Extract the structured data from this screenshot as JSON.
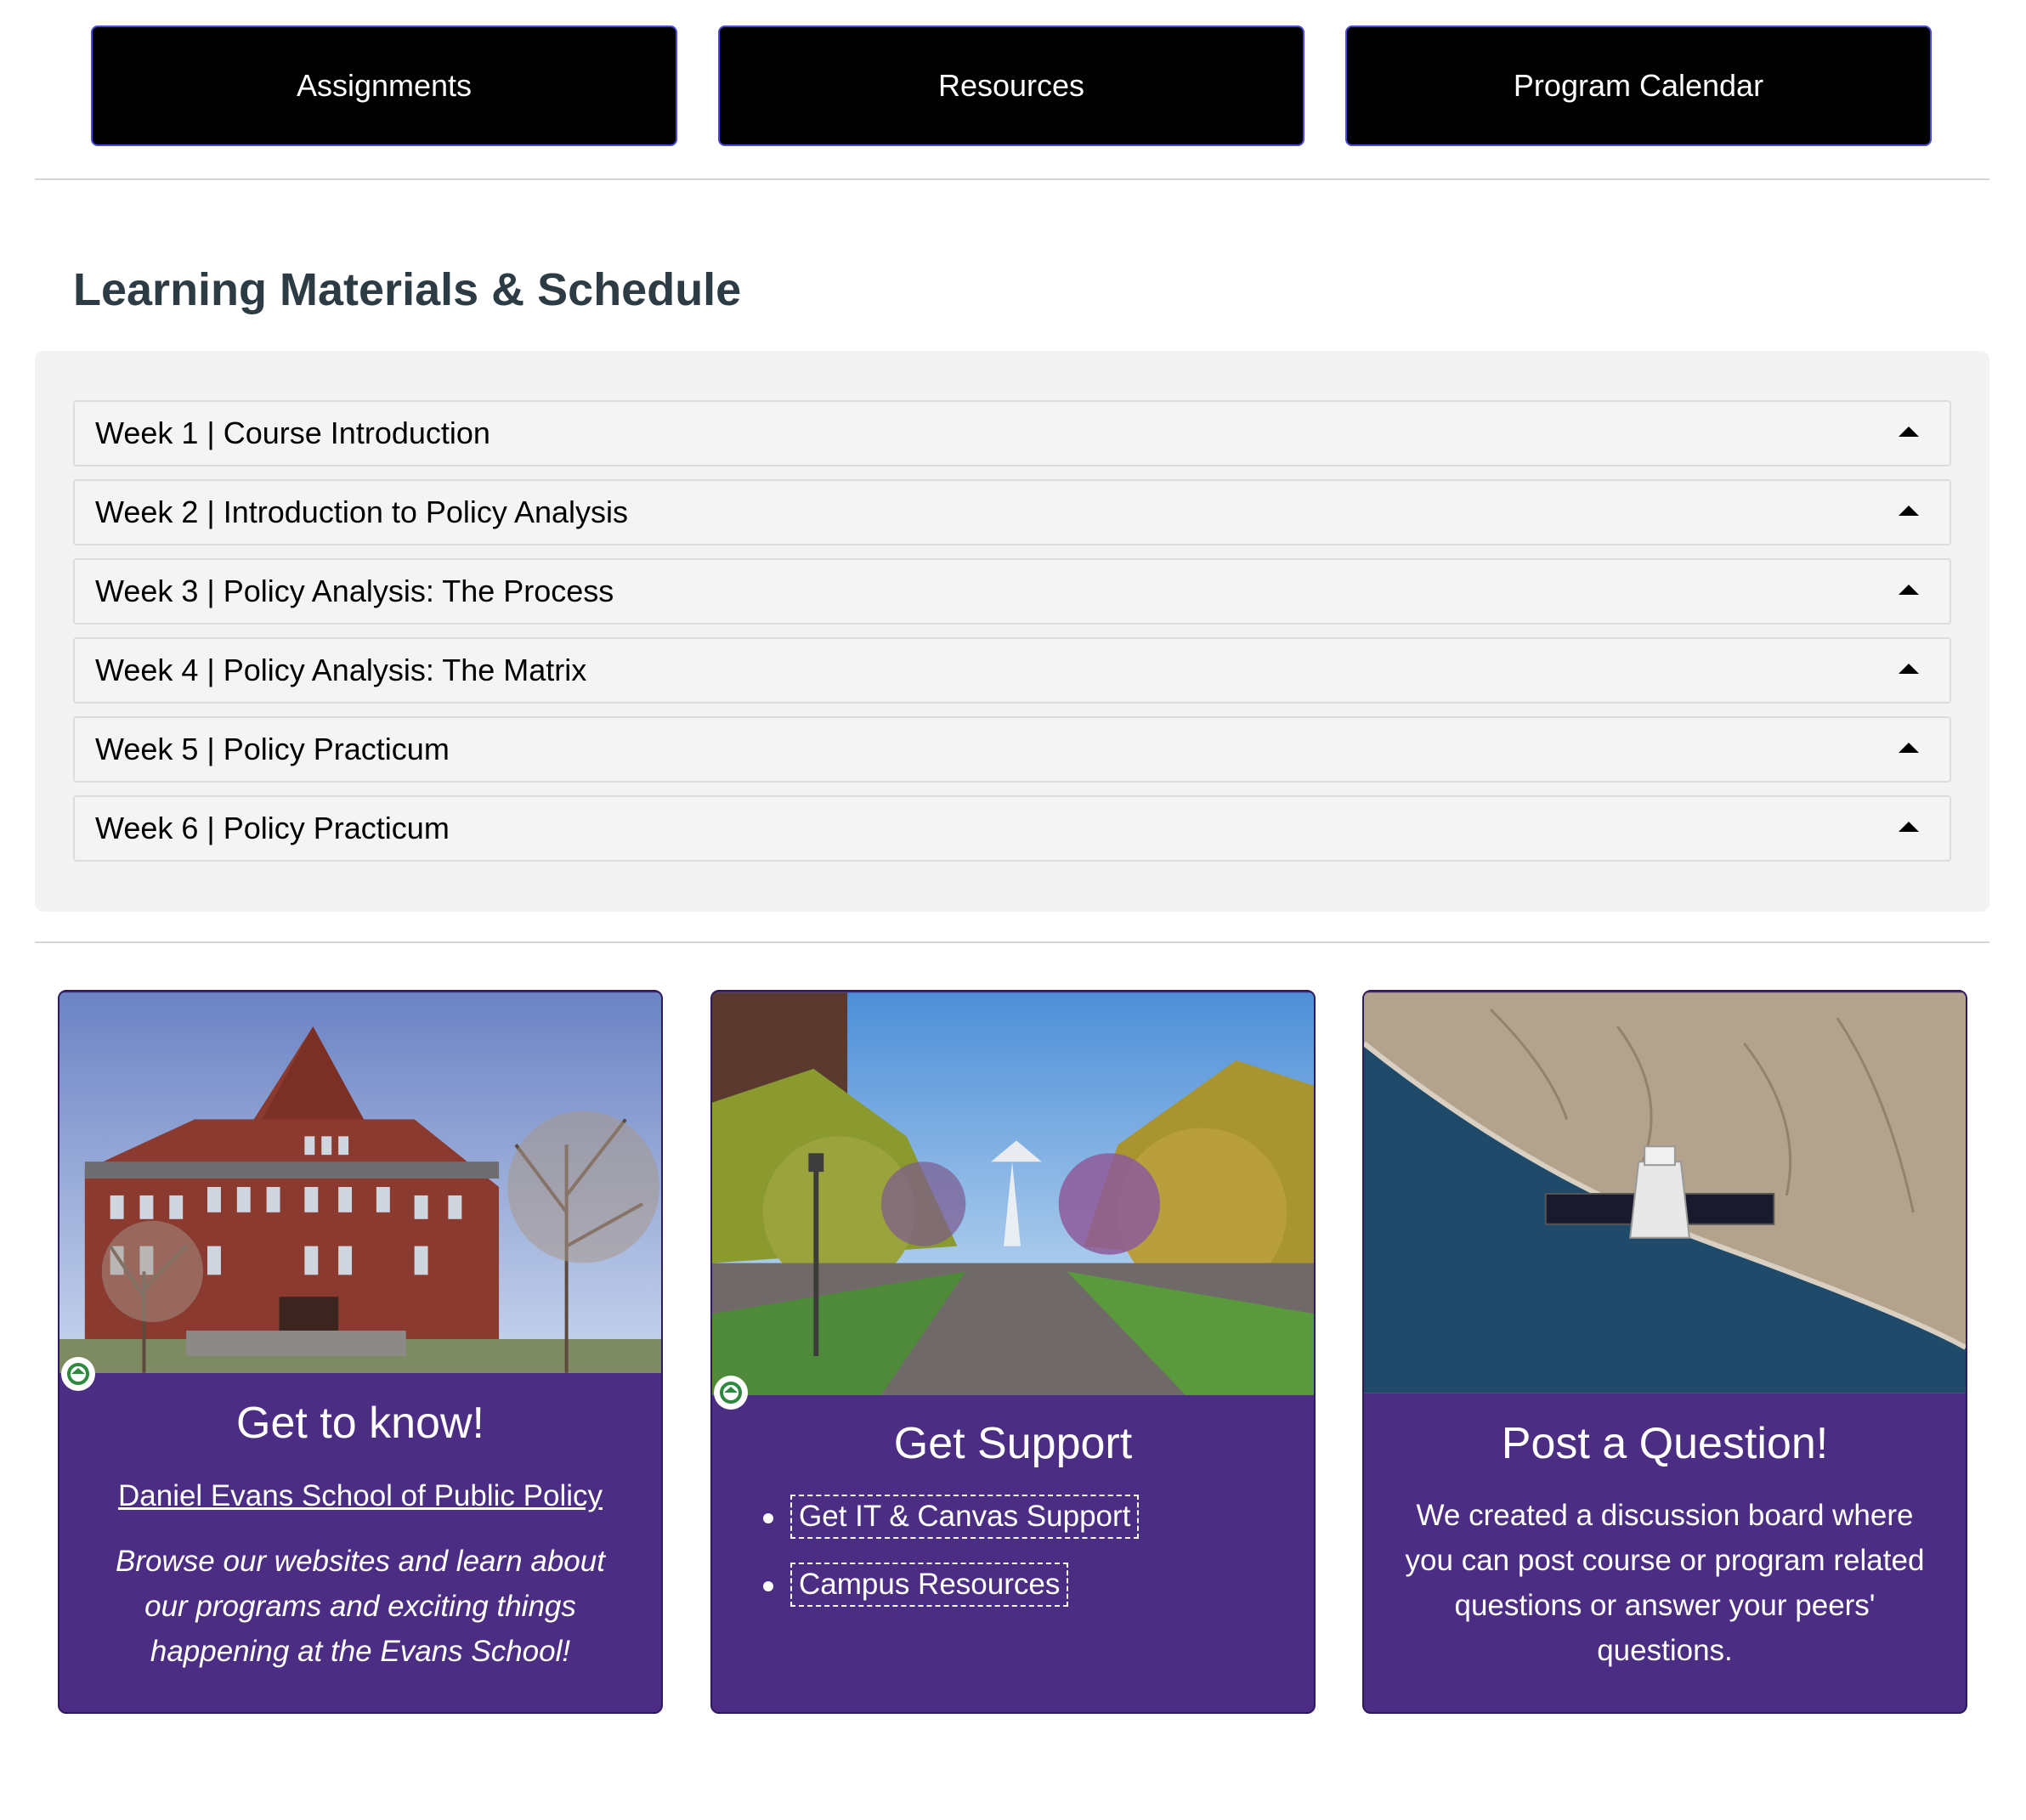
{
  "nav": {
    "buttons": [
      {
        "label": "Assignments"
      },
      {
        "label": "Resources"
      },
      {
        "label": "Program Calendar"
      }
    ]
  },
  "learning": {
    "title": "Learning Materials & Schedule",
    "weeks": [
      {
        "label": "Week 1 | Course Introduction"
      },
      {
        "label": "Week 2 | Introduction to Policy Analysis"
      },
      {
        "label": "Week 3 | Policy Analysis: The Process"
      },
      {
        "label": "Week 4 | Policy Analysis: The Matrix"
      },
      {
        "label": "Week 5 | Policy Practicum"
      },
      {
        "label": "Week 6 | Policy Practicum"
      }
    ]
  },
  "cards": {
    "know": {
      "title": "Get to know!",
      "link": "Daniel Evans School of Public Policy",
      "text": "Browse our websites and learn about our programs and exciting things happening at the Evans School!"
    },
    "support": {
      "title": "Get Support",
      "links": [
        "Get IT & Canvas Support",
        "Campus Resources"
      ]
    },
    "question": {
      "title": "Post a Question!",
      "text": "We created a discussion board where you can post course or program related questions or answer your peers' questions."
    }
  },
  "colors": {
    "card_purple": "#4b2e83",
    "nav_button": "#000000",
    "accordion_bg": "#f3f3f3"
  }
}
